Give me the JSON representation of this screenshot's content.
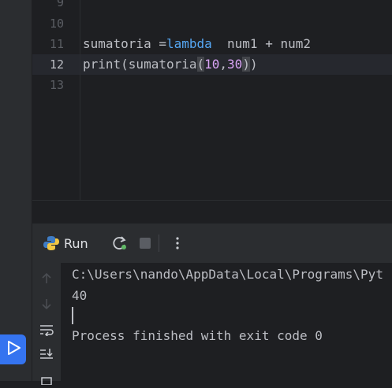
{
  "editor": {
    "line_numbers": [
      "9",
      "10",
      "11",
      "12",
      "13"
    ],
    "line11": {
      "var": "sumatoria ",
      "op": "=",
      "kw": "lambda",
      "rest": "  num1 + num2"
    },
    "line12": {
      "pre": "print(sumatoria",
      "open": "(",
      "a": "10",
      "comma": ",",
      "b": "30",
      "close": ")",
      "end": ")"
    }
  },
  "run_panel": {
    "title": "Run",
    "console_lines": [
      "C:\\Users\\nando\\AppData\\Local\\Programs\\Pyt",
      "40",
      "",
      "Process finished with exit code 0"
    ]
  },
  "colors": {
    "accent": "#3574f0",
    "keyword": "#56a8f5",
    "number": "#d9a4f5"
  },
  "icons": [
    "python-icon",
    "rerun-icon",
    "stop-icon",
    "more-icon",
    "scroll-up-icon",
    "scroll-down-icon",
    "soft-wrap-icon",
    "scroll-to-end-icon",
    "print-icon",
    "run-icon"
  ]
}
